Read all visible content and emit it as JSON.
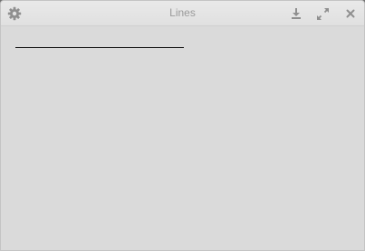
{
  "window": {
    "title": "Lines"
  },
  "titlebar": {
    "icons": {
      "settings": "gear-icon",
      "download": "download-icon",
      "expand": "expand-icon",
      "close": "close-icon"
    },
    "icon_color": "#8f8f8f"
  },
  "content": {
    "background": "#dadada",
    "line_color": "#111111"
  }
}
